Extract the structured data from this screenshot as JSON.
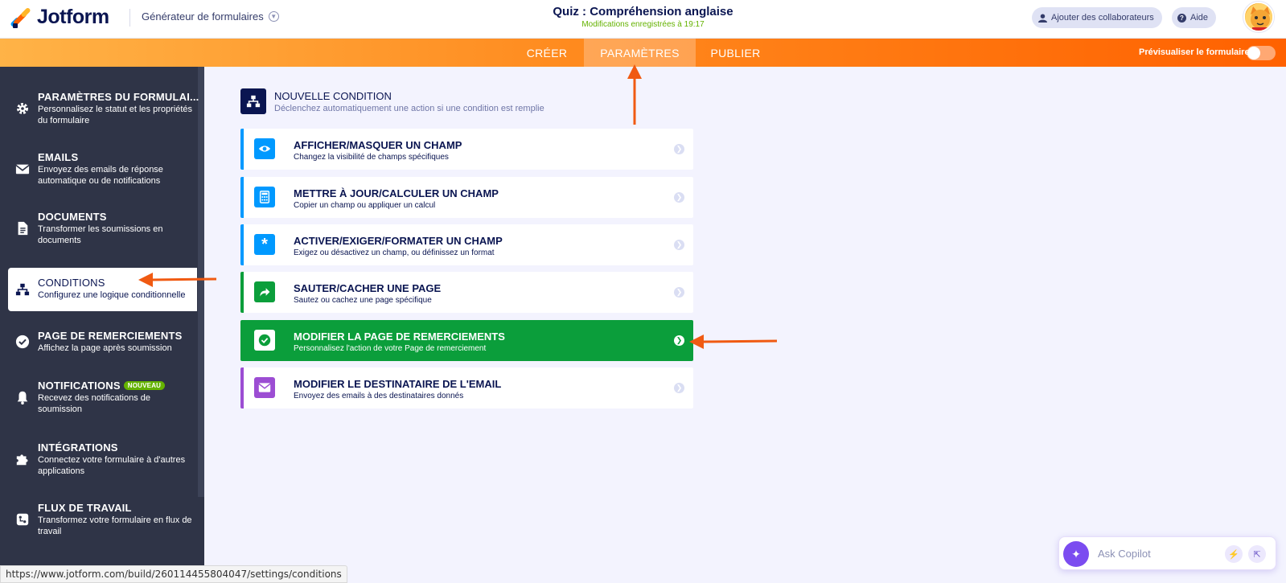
{
  "header": {
    "logo_text": "Jotform",
    "builder_label": "Générateur de formulaires",
    "form_title": "Quiz : Compréhension anglaise",
    "save_status": "Modifications enregistrées à 19:17",
    "collab_label": "Ajouter des collaborateurs",
    "help_label": "Aide"
  },
  "nav": {
    "tabs": [
      {
        "label": "CRÉER",
        "active": false
      },
      {
        "label": "PARAMÈTRES",
        "active": true
      },
      {
        "label": "PUBLIER",
        "active": false
      }
    ],
    "preview_label": "Prévisualiser le formulaire"
  },
  "sidebar": {
    "items": [
      {
        "title": "PARAMÈTRES DU FORMULAI...",
        "desc": "Personnalisez le statut et les propriétés du formulaire",
        "icon": "gear-icon"
      },
      {
        "title": "EMAILS",
        "desc": "Envoyez des emails de réponse automatique ou de notifications",
        "icon": "envelope-icon"
      },
      {
        "title": "DOCUMENTS",
        "desc": "Transformer les soumissions en documents",
        "icon": "document-icon"
      },
      {
        "title": "CONDITIONS",
        "desc": "Configurez une logique conditionnelle",
        "icon": "sitemap-icon",
        "active": true
      },
      {
        "title": "PAGE DE REMERCIEMENTS",
        "desc": "Affichez la page après soumission",
        "icon": "check-circle-icon"
      },
      {
        "title": "NOTIFICATIONS",
        "desc": "Recevez des notifications de soumission",
        "icon": "bell-icon",
        "badge": "NOUVEAU"
      },
      {
        "title": "INTÉGRATIONS",
        "desc": "Connectez votre formulaire à d'autres applications",
        "icon": "puzzle-icon"
      },
      {
        "title": "FLUX DE TRAVAIL",
        "desc": "Transformez votre formulaire en flux de travail",
        "icon": "workflow-icon"
      }
    ]
  },
  "main": {
    "new_condition": {
      "title": "NOUVELLE CONDITION",
      "desc": "Déclenchez automatiquement une action si une condition est remplie"
    },
    "conditions": [
      {
        "title": "AFFICHER/MASQUER UN CHAMP",
        "desc": "Changez la visibilité de champs spécifiques",
        "icon": "eye-icon",
        "color": "#0099ff"
      },
      {
        "title": "METTRE À JOUR/CALCULER UN CHAMP",
        "desc": "Copier un champ ou appliquer un calcul",
        "icon": "calculator-icon",
        "color": "#0099ff"
      },
      {
        "title": "ACTIVER/EXIGER/FORMATER UN CHAMP",
        "desc": "Exigez ou désactivez un champ, ou définissez un format",
        "icon": "asterisk-icon",
        "color": "#0099ff"
      },
      {
        "title": "SAUTER/CACHER UNE PAGE",
        "desc": "Sautez ou cachez une page spécifique",
        "icon": "share-arrow-icon",
        "color": "#0b9e3b"
      },
      {
        "title": "MODIFIER LA PAGE DE REMERCIEMENTS",
        "desc": "Personnalisez l'action de votre Page de remerciement",
        "icon": "check-icon",
        "color": "#0b9e3b",
        "highlight": true
      },
      {
        "title": "MODIFIER LE DESTINATAIRE DE L'EMAIL",
        "desc": "Envoyez des emails à des destinataires donnés",
        "icon": "envelope-icon",
        "color": "#9c4dd3"
      }
    ]
  },
  "status_url": "https://www.jotform.com/build/260114455804047/settings/conditions",
  "copilot": {
    "placeholder": "Ask Copilot"
  },
  "colors": {
    "accent_orange": "#ff6100",
    "sidebar_bg": "#2f3447",
    "navy": "#0a1551",
    "green": "#0b9e3b"
  }
}
